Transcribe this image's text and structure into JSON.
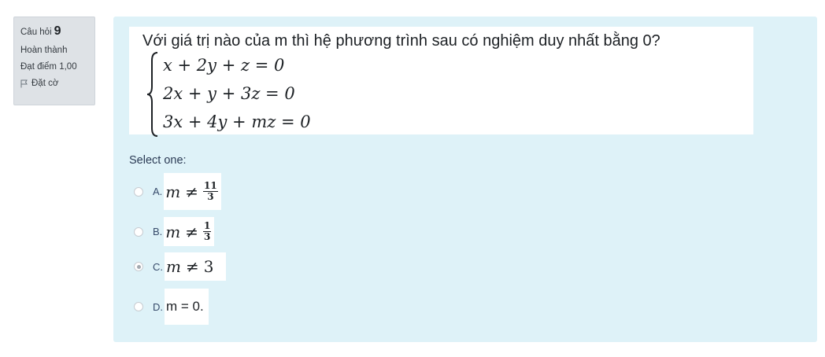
{
  "question_info": {
    "label": "Câu hỏi",
    "number": "9",
    "status": "Hoàn thành",
    "grade": "Đạt điểm 1,00",
    "flag_label": "Đặt cờ"
  },
  "question": {
    "text": "Với giá trị nào của m thì hệ phương trình sau có nghiệm duy nhất bằng 0?",
    "equations": [
      "x + 2y + z = 0",
      "2x + y + 3z = 0",
      "3x + 4y + mz = 0"
    ]
  },
  "prompt": "Select one:",
  "options": [
    {
      "letter": "A.",
      "var": "m",
      "op": "≠",
      "num": "11",
      "den": "3",
      "selected": false
    },
    {
      "letter": "B.",
      "var": "m",
      "op": "≠",
      "num": "1",
      "den": "3",
      "selected": false
    },
    {
      "letter": "C.",
      "var": "m",
      "op": "≠",
      "value": "3",
      "selected": true
    },
    {
      "letter": "D.",
      "text": "m = 0.",
      "selected": false
    }
  ],
  "colors": {
    "panel": "#def2f8",
    "info_bg": "#dee2e6"
  }
}
